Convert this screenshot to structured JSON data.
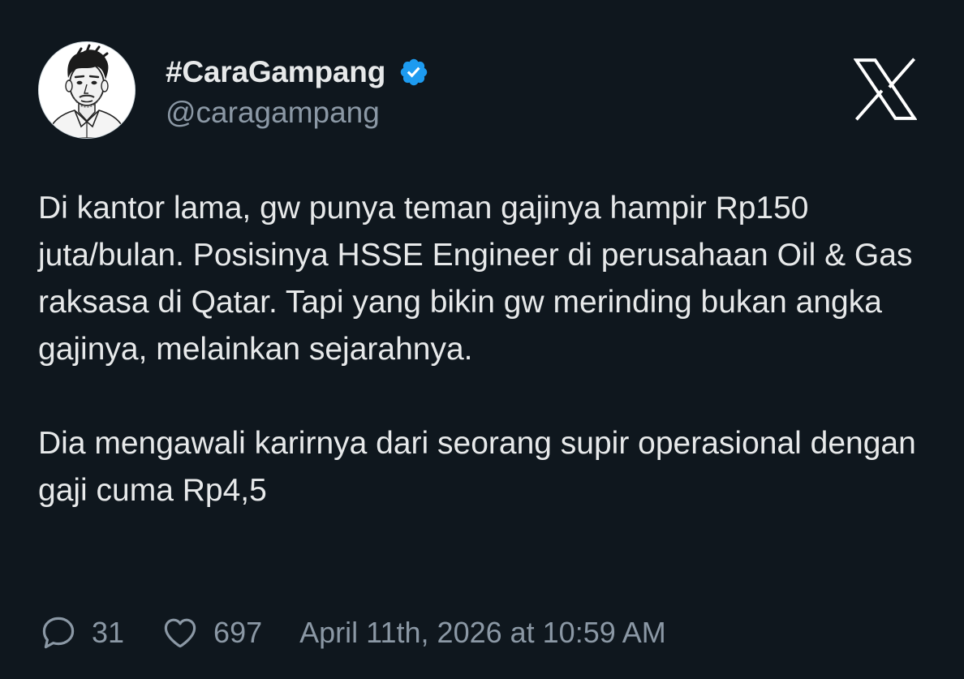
{
  "author": {
    "display_name": "#CaraGampang",
    "handle": "@caragampang",
    "verified": true,
    "avatar_icon": "cartoon-portrait-avatar",
    "verified_badge_color": "#1d9bf0"
  },
  "platform": {
    "logo_icon": "x-logo-icon"
  },
  "tweet": {
    "paragraphs": [
      "Di kantor lama, gw punya teman gajinya hampir Rp150 juta/bulan. Posisinya HSSE Engineer di perusahaan Oil & Gas raksasa di Qatar. Tapi yang bikin gw merinding bukan angka gajinya, melainkan sejarahnya.",
      "Dia mengawali karirnya dari seorang supir operasional dengan gaji cuma Rp4,5"
    ]
  },
  "stats": {
    "replies": "31",
    "reply_icon": "speech-bubble-icon",
    "likes": "697",
    "like_icon": "heart-icon",
    "timestamp": "April 11th, 2026 at 10:59 AM"
  },
  "colors": {
    "background": "#0f171e",
    "primary_text": "#e7e9ea",
    "secondary_text": "#8b98a5"
  }
}
